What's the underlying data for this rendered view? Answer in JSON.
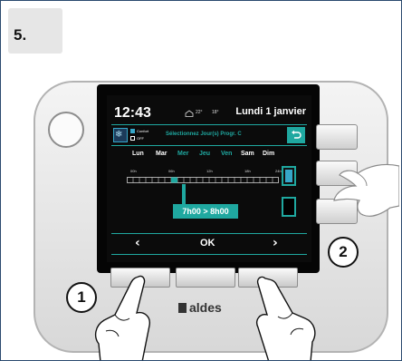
{
  "step": {
    "number": "5."
  },
  "screen": {
    "time": "12:43",
    "temp_indoor": "22°",
    "temp_outdoor": "18°",
    "date": "Lundi 1 janvier",
    "legend": {
      "comfort": "Confort",
      "off": "OFF"
    },
    "instruction": "Sélectionnez Jour(s) Progr. C",
    "days": [
      {
        "label": "Lun",
        "active": false
      },
      {
        "label": "Mar",
        "active": false
      },
      {
        "label": "Mer",
        "active": true
      },
      {
        "label": "Jeu",
        "active": true
      },
      {
        "label": "Ven",
        "active": true
      },
      {
        "label": "Sam",
        "active": false
      },
      {
        "label": "Dim",
        "active": false
      }
    ],
    "ticks": [
      "00h",
      "06h",
      "12h",
      "18h",
      "24h"
    ],
    "time_range": "7h00 > 8h00",
    "nav": {
      "prev": "‹",
      "ok": "OK",
      "next": "›"
    }
  },
  "device": {
    "brand": "aldes"
  },
  "callouts": {
    "one": "1",
    "two": "2"
  },
  "icons": {
    "mode": "snowflake-icon",
    "back": "back-arrow-icon",
    "temperature": "house-temperature-icon"
  },
  "colors": {
    "accent": "#1fa8a0",
    "comfort": "#36a7c9",
    "screen_bg": "#0b0b0b"
  }
}
